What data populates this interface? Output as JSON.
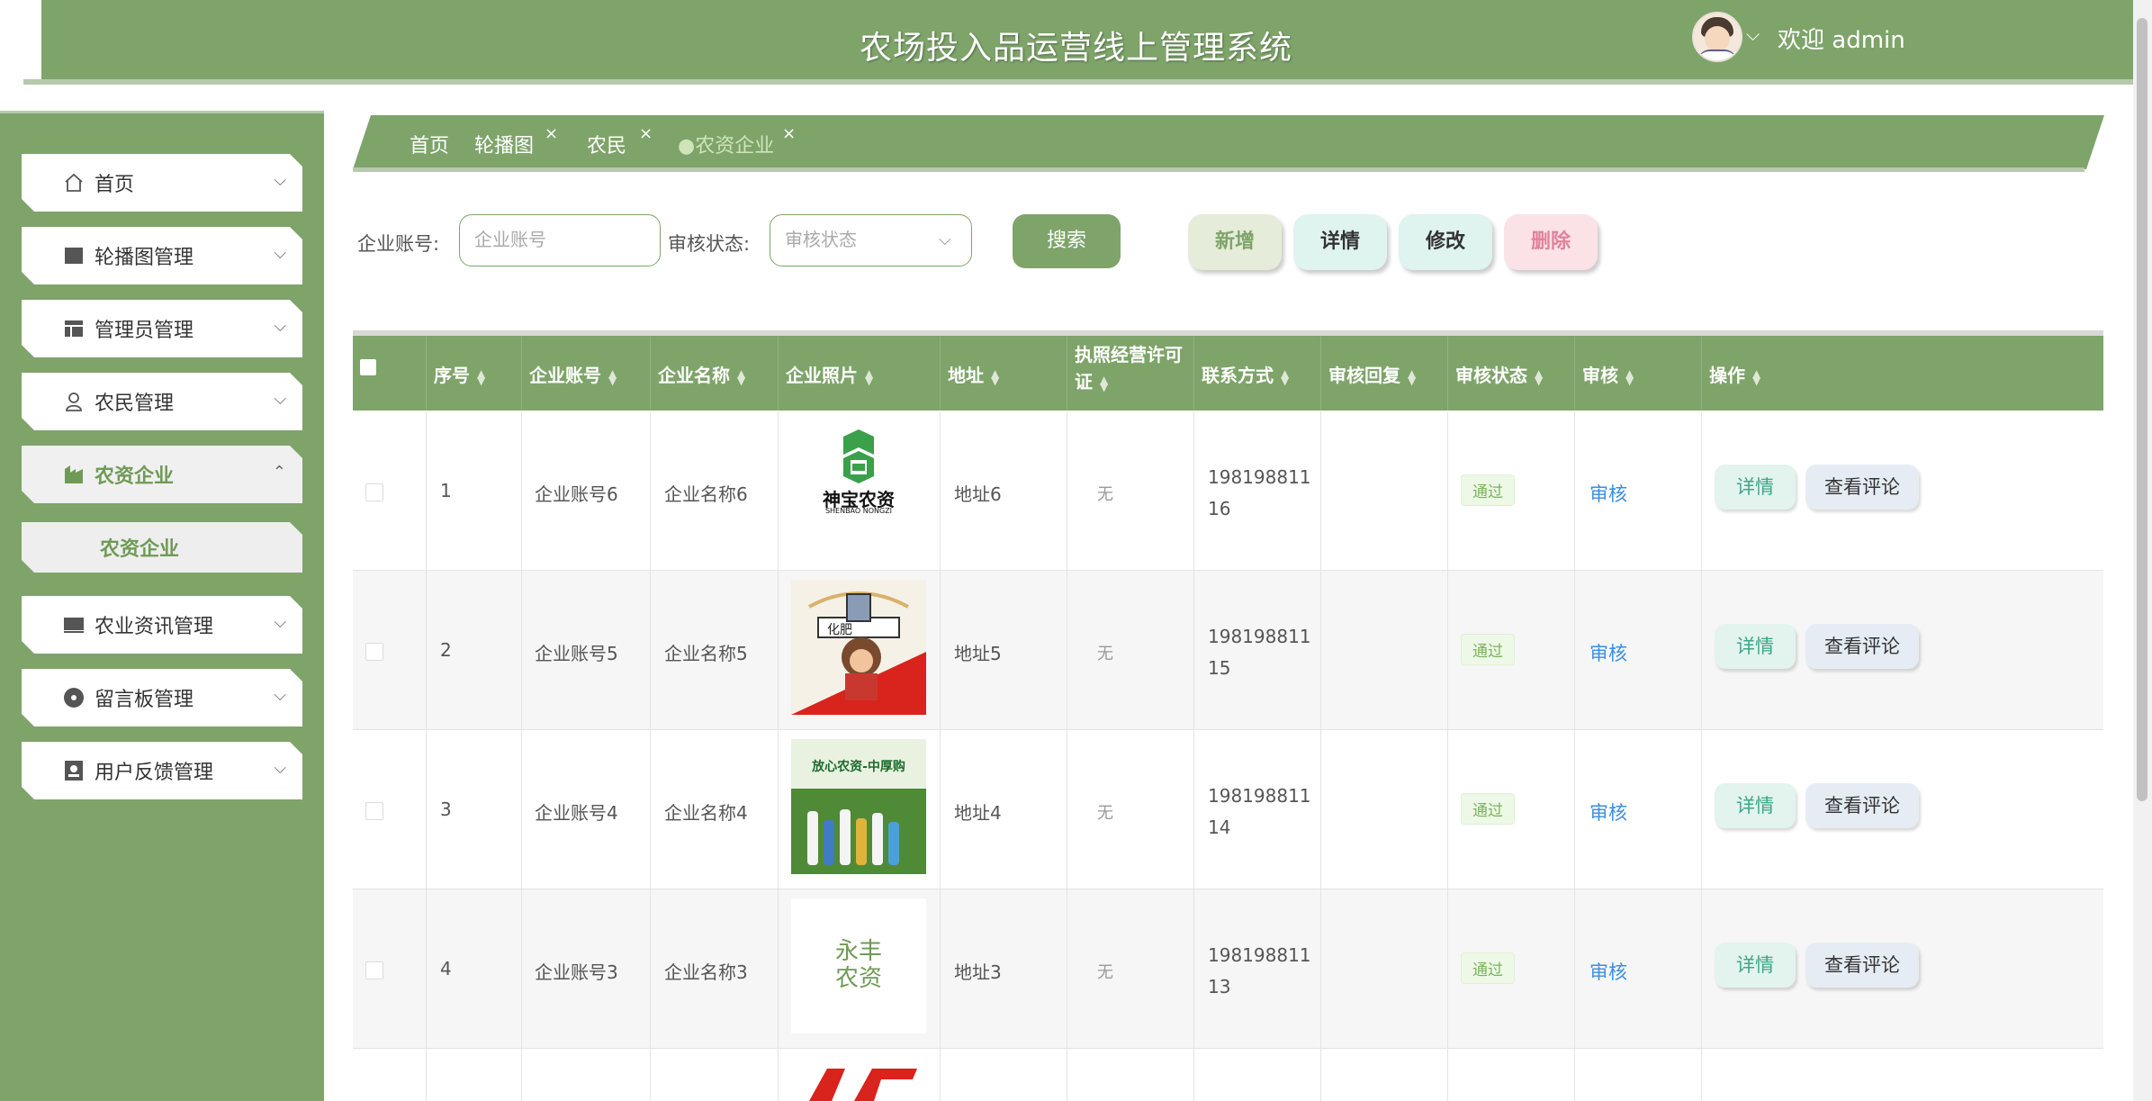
{
  "header": {
    "title": "农场投入品运营线上管理系统",
    "welcome": "欢迎 admin"
  },
  "sidebar": {
    "items": [
      {
        "label": "首页",
        "icon": "home-icon"
      },
      {
        "label": "轮播图管理",
        "icon": "carousel-icon"
      },
      {
        "label": "管理员管理",
        "icon": "admin-icon"
      },
      {
        "label": "农民管理",
        "icon": "user-icon"
      },
      {
        "label": "农资企业",
        "icon": "factory-icon"
      },
      {
        "label": "农业资讯管理",
        "icon": "monitor-icon"
      },
      {
        "label": "留言板管理",
        "icon": "message-icon"
      },
      {
        "label": "用户反馈管理",
        "icon": "feedback-icon"
      }
    ],
    "submenu": "农资企业"
  },
  "tabs": [
    {
      "label": "首页"
    },
    {
      "label": "轮播图"
    },
    {
      "label": "农民"
    },
    {
      "label": "●农资企业"
    }
  ],
  "search": {
    "account_label": "企业账号:",
    "account_placeholder": "企业账号",
    "status_label": "审核状态:",
    "status_placeholder": "审核状态",
    "search_btn": "搜索"
  },
  "actions": {
    "add": "新增",
    "detail": "详情",
    "edit": "修改",
    "delete": "删除"
  },
  "table": {
    "headers": [
      "序号",
      "企业账号",
      "企业名称",
      "企业照片",
      "地址",
      "执照经营许可证",
      "联系方式",
      "审核回复",
      "审核状态",
      "审核",
      "操作"
    ],
    "rows": [
      {
        "idx": "1",
        "account": "企业账号6",
        "name": "企业名称6",
        "address": "地址6",
        "license": "无",
        "phone": "19819881116",
        "reply": "",
        "status": "通过",
        "audit": "审核",
        "detail": "详情",
        "review": "查看评论"
      },
      {
        "idx": "2",
        "account": "企业账号5",
        "name": "企业名称5",
        "address": "地址5",
        "license": "无",
        "phone": "19819881115",
        "reply": "",
        "status": "通过",
        "audit": "审核",
        "detail": "详情",
        "review": "查看评论"
      },
      {
        "idx": "3",
        "account": "企业账号4",
        "name": "企业名称4",
        "address": "地址4",
        "license": "无",
        "phone": "19819881114",
        "reply": "",
        "status": "通过",
        "audit": "审核",
        "detail": "详情",
        "review": "查看评论"
      },
      {
        "idx": "4",
        "account": "企业账号3",
        "name": "企业名称3",
        "address": "地址3",
        "license": "无",
        "phone": "19819881113",
        "reply": "",
        "status": "通过",
        "audit": "审核",
        "detail": "详情",
        "review": "查看评论"
      }
    ]
  },
  "photos": {
    "p1_brand": "神宝农资",
    "p1_sub": "SHENBAO NONGZI",
    "p2_label": "化肥",
    "p3_label": "放心农资-中厚购",
    "p4_text": "永丰农资"
  },
  "colors": {
    "primary": "#7ea46a",
    "header_line": "#b7c9ab",
    "link": "#3a8ee6",
    "pass": "#7ab35a"
  }
}
